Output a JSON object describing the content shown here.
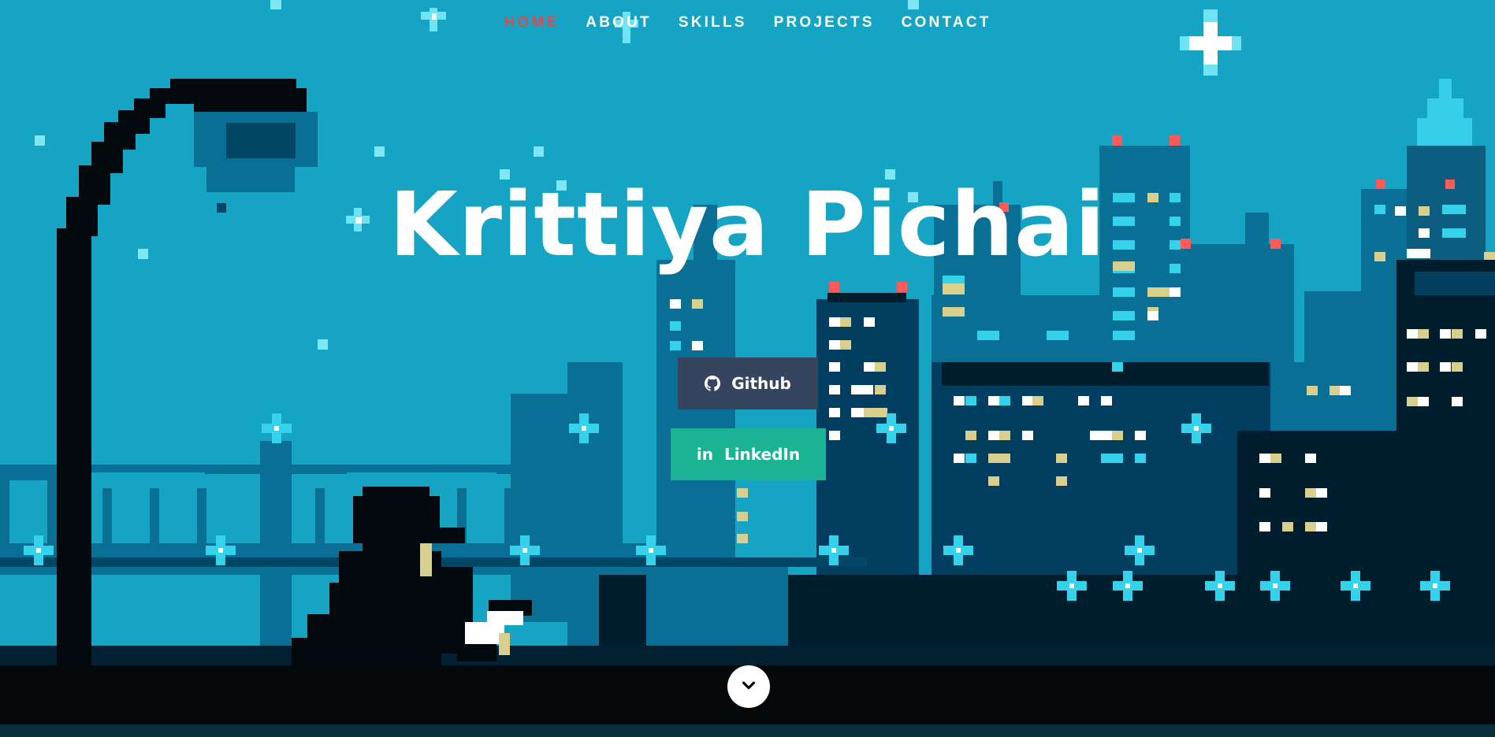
{
  "nav": {
    "items": [
      {
        "label": "HOME",
        "active": true
      },
      {
        "label": "ABOUT",
        "active": false
      },
      {
        "label": "SKILLS",
        "active": false
      },
      {
        "label": "PROJECTS",
        "active": false
      },
      {
        "label": "CONTACT",
        "active": false
      }
    ]
  },
  "hero": {
    "name": "Krittiya Pichai"
  },
  "buttons": {
    "github_label": "Github",
    "github_icon": "github-icon",
    "linkedin_label": "LinkedIn",
    "linkedin_icon": "linkedin-icon"
  },
  "scroll": {
    "icon": "chevron-down-icon"
  },
  "colors": {
    "sky": "#16a4c4",
    "nav_active": "#e2484b",
    "github_button": "#36455e",
    "linkedin_button": "#1ab394",
    "window_white": "#ffffff",
    "window_cyan": "#35d2ec",
    "window_yellow": "#d9cf8c",
    "beacon_red": "#ff5a5a"
  }
}
